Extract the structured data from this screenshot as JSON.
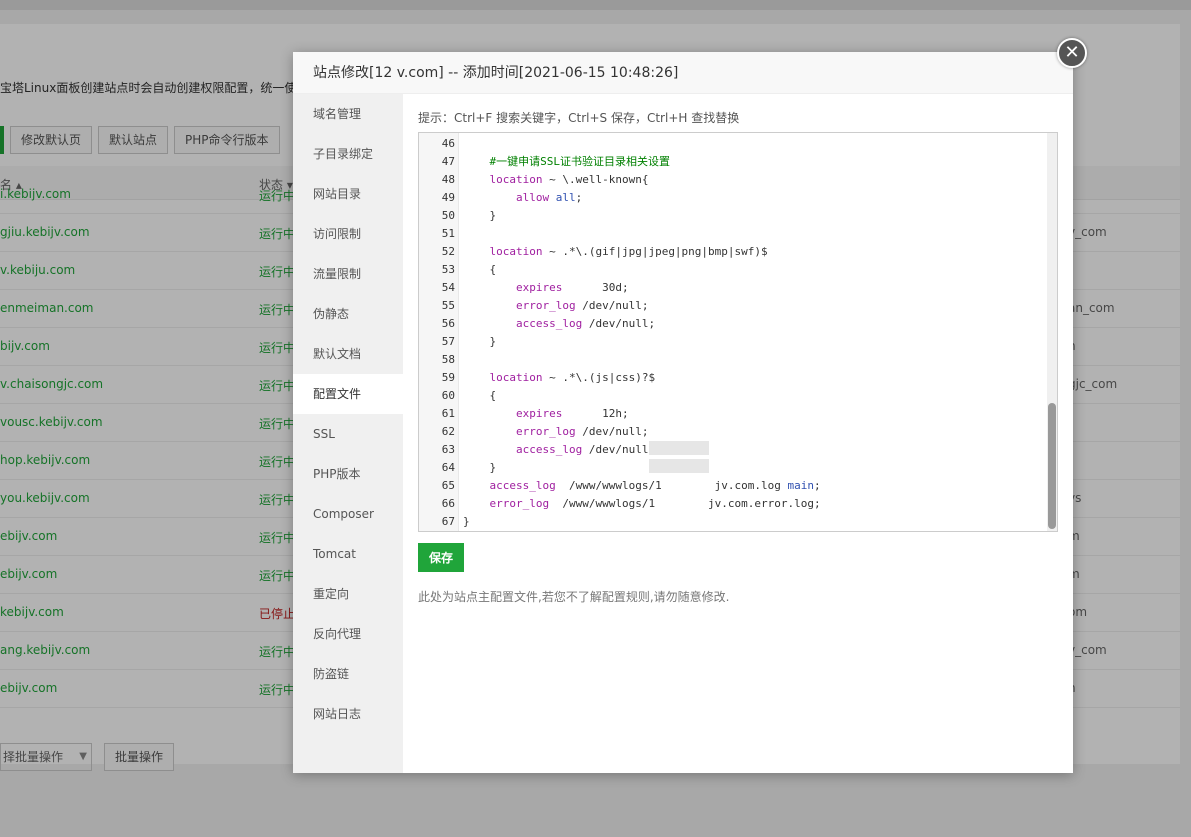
{
  "background": {
    "tip": "宝塔Linux面板创建站点时会自动创建权限配置，统一使用",
    "toolbar": [
      "修改默认页",
      "默认站点",
      "PHP命令行版本"
    ],
    "table_head": {
      "name": "名 ▴",
      "status": "状态 ▾"
    },
    "rows": [
      {
        "name": "i.kebijv.com",
        "status": "运行中",
        "right": ""
      },
      {
        "name": "gjiu.kebijv.com",
        "status": "运行中",
        "right": "v_com"
      },
      {
        "name": "v.kebiju.com",
        "status": "运行中",
        "right": ""
      },
      {
        "name": "enmeiman.com",
        "status": "运行中",
        "right": "an_com"
      },
      {
        "name": "bijv.com",
        "status": "运行中",
        "right": "n"
      },
      {
        "name": "v.chaisongjc.com",
        "status": "运行中",
        "right": "gjc_com"
      },
      {
        "name": "vousc.kebijv.com",
        "status": "运行中",
        "right": ""
      },
      {
        "name": "hop.kebijv.com",
        "status": "运行中",
        "right": ""
      },
      {
        "name": "you.kebijv.com",
        "status": "运行中",
        "right": "vs"
      },
      {
        "name": "ebijv.com",
        "status": "运行中",
        "right": "m"
      },
      {
        "name": "ebijv.com",
        "status": "运行中",
        "right": "m"
      },
      {
        "name": "kebijv.com",
        "status": "已停止",
        "right": "om"
      },
      {
        "name": "ang.kebijv.com",
        "status": "运行中",
        "right": "v_com"
      },
      {
        "name": "ebijv.com",
        "status": "运行中",
        "right": "n"
      }
    ],
    "batch_select": "择批量操作",
    "batch_button": "批量操作"
  },
  "modal": {
    "title": "站点修改[12        v.com] -- 添加时间[2021-06-15 10:48:26]",
    "close_glyph": "✕",
    "menu": [
      "域名管理",
      "子目录绑定",
      "网站目录",
      "访问限制",
      "流量限制",
      "伪静态",
      "默认文档",
      "配置文件",
      "SSL",
      "PHP版本",
      "Composer",
      "Tomcat",
      "重定向",
      "反向代理",
      "防盗链",
      "网站日志"
    ],
    "active_menu": "配置文件",
    "hint": "提示：Ctrl+F 搜索关键字，Ctrl+S 保存，Ctrl+H 查找替换",
    "save_label": "保存",
    "note": "此处为站点主配置文件,若您不了解配置规则,请勿随意修改."
  },
  "code_lines": [
    {
      "n": "46",
      "t": ""
    },
    {
      "n": "47",
      "t": "    #一键申请SSL证书验证目录相关设置"
    },
    {
      "n": "48",
      "t": "    location ~ \\.well-known{"
    },
    {
      "n": "49",
      "t": "        allow all;"
    },
    {
      "n": "50",
      "t": "    }"
    },
    {
      "n": "51",
      "t": ""
    },
    {
      "n": "52",
      "t": "    location ~ .*\\.(gif|jpg|jpeg|png|bmp|swf)$"
    },
    {
      "n": "53",
      "t": "    {"
    },
    {
      "n": "54",
      "t": "        expires      30d;"
    },
    {
      "n": "55",
      "t": "        error_log /dev/null;"
    },
    {
      "n": "56",
      "t": "        access_log /dev/null;"
    },
    {
      "n": "57",
      "t": "    }"
    },
    {
      "n": "58",
      "t": ""
    },
    {
      "n": "59",
      "t": "    location ~ .*\\.(js|css)?$"
    },
    {
      "n": "60",
      "t": "    {"
    },
    {
      "n": "61",
      "t": "        expires      12h;"
    },
    {
      "n": "62",
      "t": "        error_log /dev/null;"
    },
    {
      "n": "63",
      "t": "        access_log /dev/null;"
    },
    {
      "n": "64",
      "t": "    }"
    },
    {
      "n": "65",
      "t": "    access_log  /www/wwwlogs/1        jv.com.log main;"
    },
    {
      "n": "66",
      "t": "    error_log  /www/wwwlogs/1        jv.com.error.log;"
    },
    {
      "n": "67",
      "t": "}"
    }
  ],
  "colors": {
    "accent": "#20a53a",
    "stopped": "#c02020"
  }
}
